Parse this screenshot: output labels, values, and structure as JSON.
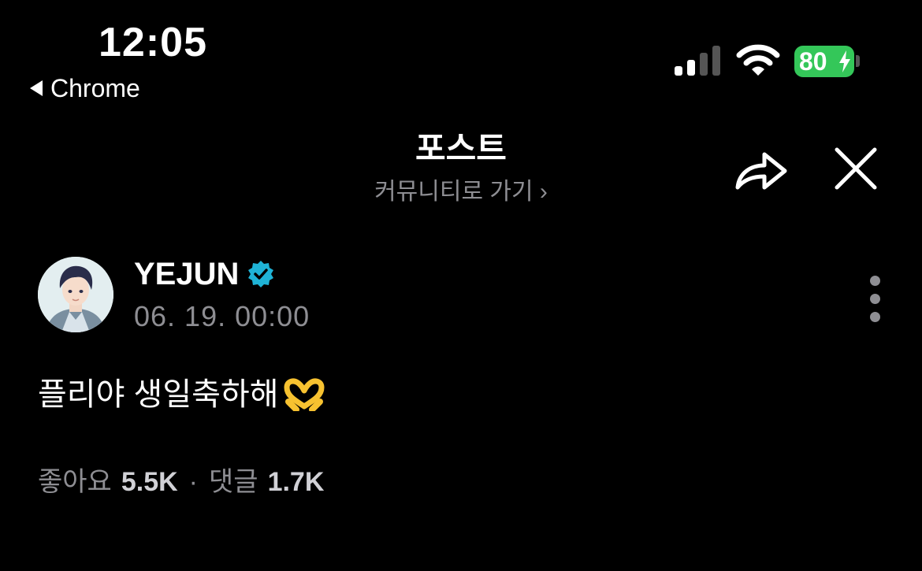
{
  "status_bar": {
    "time": "12:05",
    "back_app": "Chrome",
    "battery_level": "80",
    "signal_bars_active": 2,
    "signal_bars_total": 4
  },
  "header": {
    "title": "포스트",
    "subtitle": "커뮤니티로 가기 ›"
  },
  "post": {
    "author": "YEJUN",
    "verified": true,
    "timestamp": "06. 19. 00:00",
    "text": "플리야 생일축하해",
    "emoji_icon": "heart-hands-emoji",
    "likes_label": "좋아요",
    "likes_value": "5.5K",
    "separator": "·",
    "comments_label": "댓글",
    "comments_value": "1.7K"
  },
  "colors": {
    "background": "#000000",
    "battery": "#34c759",
    "verified": "#1fb3d6",
    "secondary_text": "#8e8e93"
  }
}
